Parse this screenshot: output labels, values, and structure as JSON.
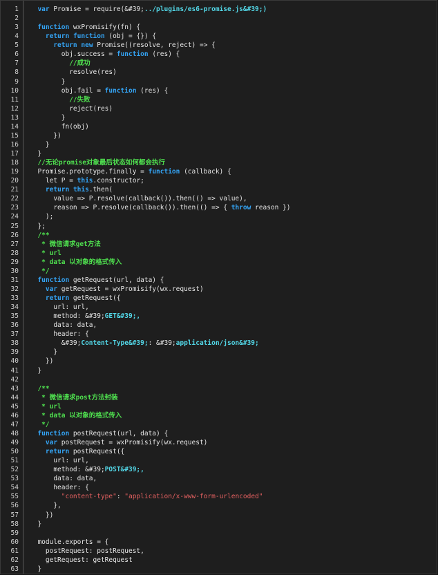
{
  "editor": {
    "lines": [
      {
        "n": "1",
        "t": [
          [
            "  var",
            "kw"
          ],
          [
            " Promise = require(&#39;",
            ""
          ],
          [
            "../plugins/es6-promise.js&#39;)",
            "st"
          ]
        ]
      },
      {
        "n": "2",
        "t": []
      },
      {
        "n": "3",
        "t": [
          [
            "  function",
            "kw"
          ],
          [
            " wxPromisify(fn) {",
            ""
          ]
        ]
      },
      {
        "n": "4",
        "t": [
          [
            "    return",
            "kw"
          ],
          [
            " ",
            ""
          ],
          [
            "function",
            "kw"
          ],
          [
            " (obj = {}) {",
            ""
          ]
        ]
      },
      {
        "n": "5",
        "t": [
          [
            "      return",
            "kw"
          ],
          [
            " ",
            ""
          ],
          [
            "new",
            "kw"
          ],
          [
            " Promise((resolve, reject) => {",
            ""
          ]
        ]
      },
      {
        "n": "6",
        "t": [
          [
            "        obj.success = ",
            ""
          ],
          [
            "function",
            "kw"
          ],
          [
            " (res) {",
            ""
          ]
        ]
      },
      {
        "n": "7",
        "t": [
          [
            "          //成功",
            "cm"
          ]
        ]
      },
      {
        "n": "8",
        "t": [
          [
            "          resolve(res)",
            ""
          ]
        ]
      },
      {
        "n": "9",
        "t": [
          [
            "        }",
            ""
          ]
        ]
      },
      {
        "n": "10",
        "t": [
          [
            "        obj.fail = ",
            ""
          ],
          [
            "function",
            "kw"
          ],
          [
            " (res) {",
            ""
          ]
        ]
      },
      {
        "n": "11",
        "t": [
          [
            "          //失败",
            "cm"
          ]
        ]
      },
      {
        "n": "12",
        "t": [
          [
            "          reject(res)",
            ""
          ]
        ]
      },
      {
        "n": "13",
        "t": [
          [
            "        }",
            ""
          ]
        ]
      },
      {
        "n": "14",
        "t": [
          [
            "        fn(obj)",
            ""
          ]
        ]
      },
      {
        "n": "15",
        "t": [
          [
            "      })",
            ""
          ]
        ]
      },
      {
        "n": "16",
        "t": [
          [
            "    }",
            ""
          ]
        ]
      },
      {
        "n": "17",
        "t": [
          [
            "  }",
            ""
          ]
        ]
      },
      {
        "n": "18",
        "t": [
          [
            "  //无论promise对象最后状态如何都会执行",
            "cm"
          ]
        ]
      },
      {
        "n": "19",
        "t": [
          [
            "  Promise.prototype.finally = ",
            ""
          ],
          [
            "function",
            "kw"
          ],
          [
            " (callback) {",
            ""
          ]
        ]
      },
      {
        "n": "20",
        "t": [
          [
            "    let P = ",
            ""
          ],
          [
            "this",
            "kw"
          ],
          [
            ".constructor;",
            ""
          ]
        ]
      },
      {
        "n": "21",
        "t": [
          [
            "    return",
            "kw"
          ],
          [
            " ",
            ""
          ],
          [
            "this",
            "kw"
          ],
          [
            ".then(",
            ""
          ]
        ]
      },
      {
        "n": "22",
        "t": [
          [
            "      value => P.resolve(callback()).then(() => value),",
            ""
          ]
        ]
      },
      {
        "n": "23",
        "t": [
          [
            "      reason => P.resolve(callback()).then(() => { ",
            ""
          ],
          [
            "throw",
            "kw"
          ],
          [
            " reason })",
            ""
          ]
        ]
      },
      {
        "n": "24",
        "t": [
          [
            "    );",
            ""
          ]
        ]
      },
      {
        "n": "25",
        "t": [
          [
            "  };",
            ""
          ]
        ]
      },
      {
        "n": "26",
        "t": [
          [
            "  /**",
            "cm"
          ]
        ]
      },
      {
        "n": "27",
        "t": [
          [
            "   * 微信请求get方法",
            "cm"
          ]
        ]
      },
      {
        "n": "28",
        "t": [
          [
            "   * url",
            "cm"
          ]
        ]
      },
      {
        "n": "29",
        "t": [
          [
            "   * data 以对象的格式传入",
            "cm"
          ]
        ]
      },
      {
        "n": "30",
        "t": [
          [
            "   */",
            "cm"
          ]
        ]
      },
      {
        "n": "31",
        "t": [
          [
            "  function",
            "kw"
          ],
          [
            " getRequest(url, data) {",
            ""
          ]
        ]
      },
      {
        "n": "32",
        "t": [
          [
            "    var",
            "kw"
          ],
          [
            " getRequest = wxPromisify(wx.request)",
            ""
          ]
        ]
      },
      {
        "n": "33",
        "t": [
          [
            "    return",
            "kw"
          ],
          [
            " getRequest({",
            ""
          ]
        ]
      },
      {
        "n": "34",
        "t": [
          [
            "      url: url,",
            ""
          ]
        ]
      },
      {
        "n": "35",
        "t": [
          [
            "      method: &#39;",
            ""
          ],
          [
            "GET&#39;,",
            "st"
          ]
        ]
      },
      {
        "n": "36",
        "t": [
          [
            "      data: data,",
            ""
          ]
        ]
      },
      {
        "n": "37",
        "t": [
          [
            "      header: {",
            ""
          ]
        ]
      },
      {
        "n": "38",
        "t": [
          [
            "        &#39;",
            ""
          ],
          [
            "Content-Type&#39;",
            "st"
          ],
          [
            ": &#39;",
            ""
          ],
          [
            "application/json&#39;",
            "st"
          ]
        ]
      },
      {
        "n": "39",
        "t": [
          [
            "      }",
            ""
          ]
        ]
      },
      {
        "n": "40",
        "t": [
          [
            "    })",
            ""
          ]
        ]
      },
      {
        "n": "41",
        "t": [
          [
            "  }",
            ""
          ]
        ]
      },
      {
        "n": "42",
        "t": []
      },
      {
        "n": "43",
        "t": [
          [
            "  /**",
            "cm"
          ]
        ]
      },
      {
        "n": "44",
        "t": [
          [
            "   * 微信请求post方法封装",
            "cm"
          ]
        ]
      },
      {
        "n": "45",
        "t": [
          [
            "   * url",
            "cm"
          ]
        ]
      },
      {
        "n": "46",
        "t": [
          [
            "   * data 以对象的格式传入",
            "cm"
          ]
        ]
      },
      {
        "n": "47",
        "t": [
          [
            "   */",
            "cm"
          ]
        ]
      },
      {
        "n": "48",
        "t": [
          [
            "  function",
            "kw"
          ],
          [
            " postRequest(url, data) {",
            ""
          ]
        ]
      },
      {
        "n": "49",
        "t": [
          [
            "    var",
            "kw"
          ],
          [
            " postRequest = wxPromisify(wx.request)",
            ""
          ]
        ]
      },
      {
        "n": "50",
        "t": [
          [
            "    return",
            "kw"
          ],
          [
            " postRequest({",
            ""
          ]
        ]
      },
      {
        "n": "51",
        "t": [
          [
            "      url: url,",
            ""
          ]
        ]
      },
      {
        "n": "52",
        "t": [
          [
            "      method: &#39;",
            ""
          ],
          [
            "POST&#39;,",
            "st"
          ]
        ]
      },
      {
        "n": "53",
        "t": [
          [
            "      data: data,",
            ""
          ]
        ]
      },
      {
        "n": "54",
        "t": [
          [
            "      header: {",
            ""
          ]
        ]
      },
      {
        "n": "55",
        "t": [
          [
            "        \"content-type\"",
            "sr"
          ],
          [
            ": ",
            ""
          ],
          [
            "\"application/x-www-form-urlencoded\"",
            "sr"
          ]
        ]
      },
      {
        "n": "56",
        "t": [
          [
            "      },",
            ""
          ]
        ]
      },
      {
        "n": "57",
        "t": [
          [
            "    })",
            ""
          ]
        ]
      },
      {
        "n": "58",
        "t": [
          [
            "  }",
            ""
          ]
        ]
      },
      {
        "n": "59",
        "t": []
      },
      {
        "n": "60",
        "t": [
          [
            "  module.exports = {",
            ""
          ]
        ]
      },
      {
        "n": "61",
        "t": [
          [
            "    postRequest: postRequest,",
            ""
          ]
        ]
      },
      {
        "n": "62",
        "t": [
          [
            "    getRequest: getRequest",
            ""
          ]
        ]
      },
      {
        "n": "63",
        "t": [
          [
            "  }",
            ""
          ]
        ]
      }
    ]
  },
  "colors": {
    "keyword": "#34a4f5",
    "comment": "#4fe04f",
    "string": "#53d8e8",
    "string_alt": "#e66161",
    "text": "#e6e6e6",
    "background": "#1e1e1e"
  }
}
